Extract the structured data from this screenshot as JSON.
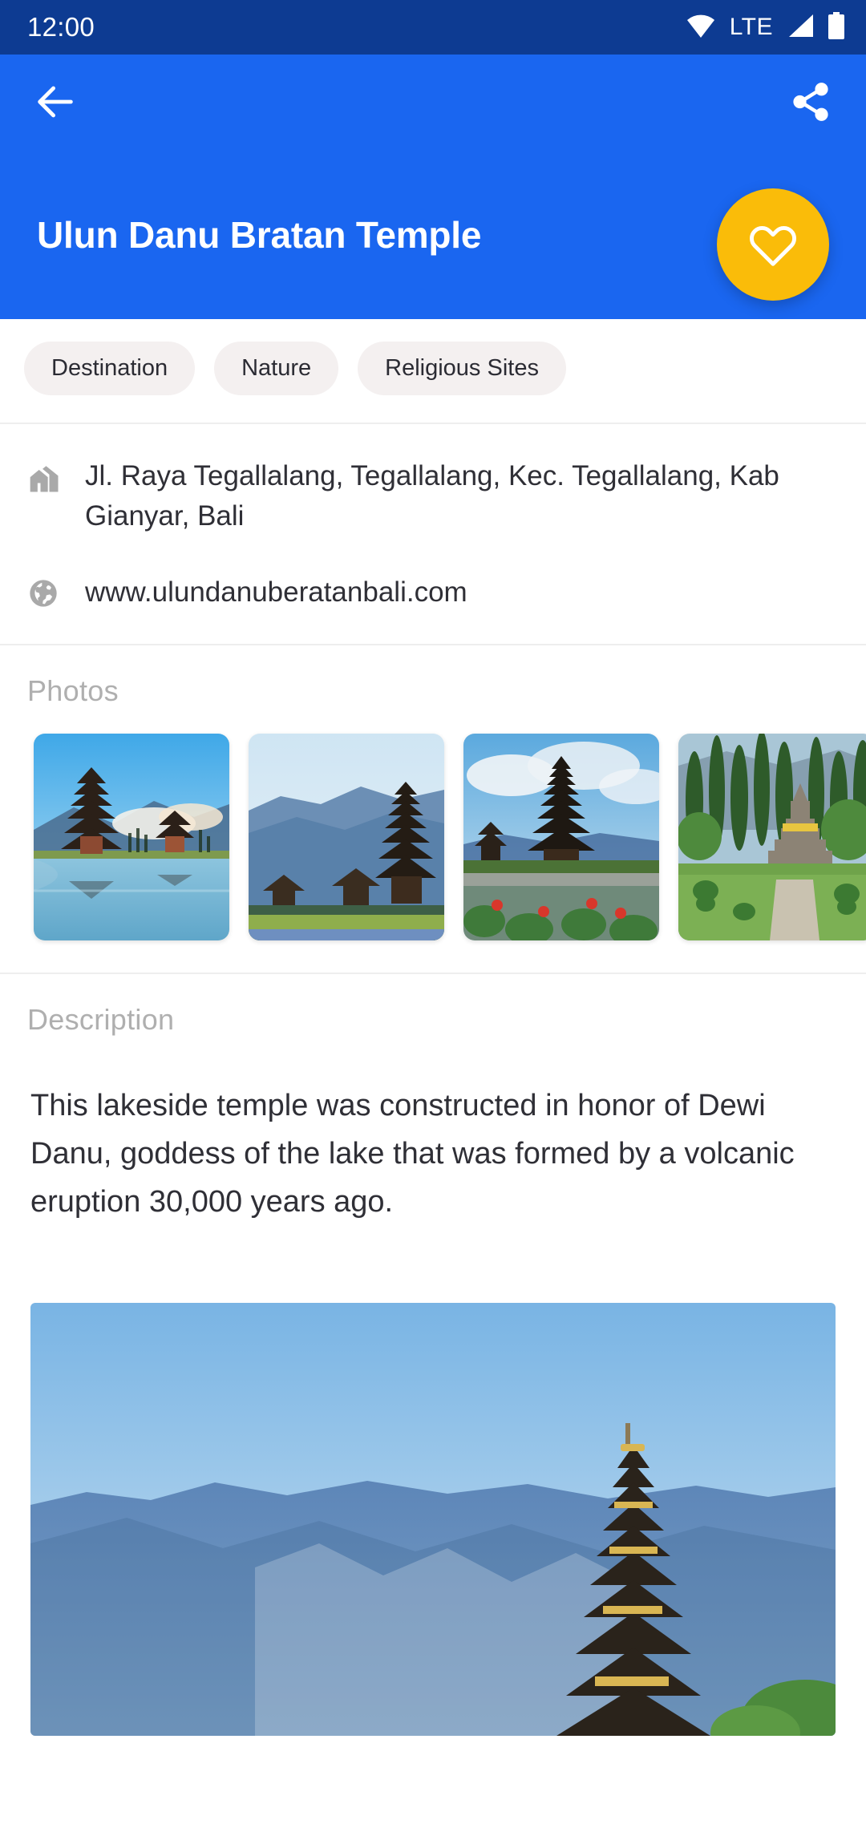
{
  "status_bar": {
    "clock": "12:00",
    "network_label": "LTE",
    "icons": [
      "wifi-icon",
      "signal-icon",
      "battery-icon"
    ],
    "background": "#0D3B92"
  },
  "app_bar": {
    "background": "#1A66F0",
    "back_icon": "arrow-back-icon",
    "share_icon": "share-icon",
    "title": "Ulun Danu Bratan Temple",
    "favorite_button": {
      "icon": "heart-outline-icon",
      "color": "#FABC09"
    }
  },
  "chips": [
    {
      "label": "Destination"
    },
    {
      "label": "Nature"
    },
    {
      "label": "Religious Sites"
    }
  ],
  "info": [
    {
      "icon": "home-building-icon",
      "text": "Jl. Raya Tegallalang, Tegallalang, Kec. Tegallalang, Kab Gianyar, Bali"
    },
    {
      "icon": "globe-icon",
      "text": "www.ulundanuberatanbali.com"
    }
  ],
  "photos_section": {
    "title": "Photos",
    "items": [
      {
        "alt": "Temple reflected on lake at sunrise with clouds"
      },
      {
        "alt": "Pagoda temple beside blue mountain ridge"
      },
      {
        "alt": "Temple in pond garden with red flowers"
      },
      {
        "alt": "Stone stupa on lawn framed by cypress trees"
      }
    ]
  },
  "description_section": {
    "title": "Description",
    "body": "This lakeside temple was constructed in honor of Dewi Danu, goddess of the lake that was formed by a volcanic eruption 30,000 years ago."
  },
  "hero_image": {
    "alt": "Tiered pagoda spire against blue forested mountain"
  },
  "palette": {
    "status_bar": "#0D3B92",
    "primary": "#1A66F0",
    "accent": "#FABC09",
    "chip_bg": "#F4F0F0",
    "section_label": "#AFAFAF",
    "body_text": "#2F2F36"
  }
}
